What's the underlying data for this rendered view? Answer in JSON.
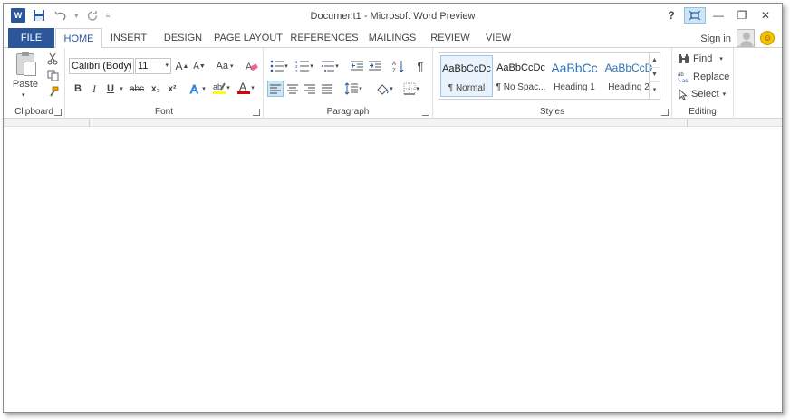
{
  "window": {
    "title": "Document1 - Microsoft Word Preview"
  },
  "qat": {
    "app_icon_letter": "W",
    "save_icon": "save-icon",
    "undo_icon": "undo-icon",
    "redo_icon": "redo-icon",
    "customize_icon": "customize-qat-icon"
  },
  "window_controls": {
    "help": "?",
    "ribbon_display": "⌗",
    "minimize": "—",
    "restore": "❐",
    "close": "✕"
  },
  "tabs": {
    "file": "FILE",
    "items": [
      "HOME",
      "INSERT",
      "DESIGN",
      "PAGE LAYOUT",
      "REFERENCES",
      "MAILINGS",
      "REVIEW",
      "VIEW"
    ],
    "active": "HOME"
  },
  "account": {
    "sign_in": "Sign in"
  },
  "clipboard": {
    "label": "Clipboard",
    "paste": "Paste"
  },
  "font": {
    "label": "Font",
    "font_name": "Calibri (Body)",
    "font_size": "11",
    "bold": "B",
    "italic": "I",
    "underline": "U",
    "strikethrough": "abc",
    "subscript": "x₂",
    "superscript": "x²",
    "change_case": "Aa",
    "grow": "A",
    "shrink": "A",
    "highlight_color": "#ffff00",
    "font_color": "#e00000"
  },
  "paragraph": {
    "label": "Paragraph",
    "pilcrow": "¶"
  },
  "styles": {
    "label": "Styles",
    "items": [
      {
        "sample": "AaBbCcDc",
        "name": "¶ Normal"
      },
      {
        "sample": "AaBbCcDc",
        "name": "¶ No Spac..."
      },
      {
        "sample": "AaBbCc",
        "name": "Heading 1"
      },
      {
        "sample": "AaBbCcD",
        "name": "Heading 2"
      }
    ],
    "heading_color": "#2e74b5"
  },
  "editing": {
    "label": "Editing",
    "find": "Find",
    "replace": "Replace",
    "select": "Select"
  },
  "colors": {
    "brand": "#2b579a",
    "selected_bg": "#cde6f7"
  }
}
